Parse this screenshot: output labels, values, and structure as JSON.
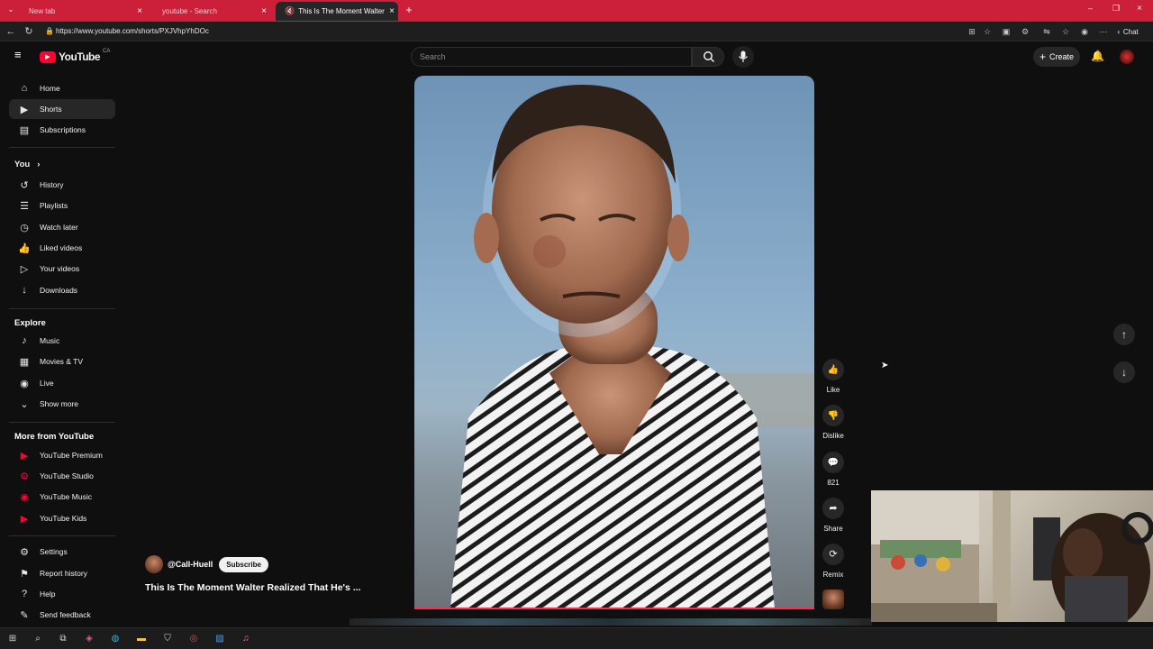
{
  "browser": {
    "tabs": [
      {
        "label": "New tab",
        "active": false
      },
      {
        "label": "youtube - Search",
        "active": false
      },
      {
        "label": "This Is The Moment Walter Re",
        "active": true
      }
    ],
    "url": "https://www.youtube.com/shorts/PXJVhpYhDOc",
    "chat_label": "Chat"
  },
  "header": {
    "logo": "YouTube",
    "region": "CA",
    "search_placeholder": "Search",
    "create_label": "Create"
  },
  "sidebar": {
    "main": [
      {
        "label": "Home",
        "icon": "home-icon",
        "glyph": "⌂"
      },
      {
        "label": "Shorts",
        "icon": "shorts-icon",
        "glyph": "▶"
      },
      {
        "label": "Subscriptions",
        "icon": "subscriptions-icon",
        "glyph": "▤"
      }
    ],
    "you_heading": "You",
    "you": [
      {
        "label": "History",
        "icon": "history-icon",
        "glyph": "↺"
      },
      {
        "label": "Playlists",
        "icon": "playlists-icon",
        "glyph": "☰"
      },
      {
        "label": "Watch later",
        "icon": "clock-icon",
        "glyph": "◷"
      },
      {
        "label": "Liked videos",
        "icon": "thumbs-up-icon",
        "glyph": "👍"
      },
      {
        "label": "Your videos",
        "icon": "video-icon",
        "glyph": "▷"
      },
      {
        "label": "Downloads",
        "icon": "download-icon",
        "glyph": "↓"
      }
    ],
    "explore_heading": "Explore",
    "explore": [
      {
        "label": "Music",
        "icon": "music-icon",
        "glyph": "♪"
      },
      {
        "label": "Movies & TV",
        "icon": "film-icon",
        "glyph": "▦"
      },
      {
        "label": "Live",
        "icon": "live-icon",
        "glyph": "◉"
      },
      {
        "label": "Show more",
        "icon": "chevron-down-icon",
        "glyph": "⌄"
      }
    ],
    "more_heading": "More from YouTube",
    "more": [
      {
        "label": "YouTube Premium",
        "icon": "youtube-premium-icon",
        "glyph": "▶"
      },
      {
        "label": "YouTube Studio",
        "icon": "youtube-studio-icon",
        "glyph": "⚙"
      },
      {
        "label": "YouTube Music",
        "icon": "youtube-music-icon",
        "glyph": "◉"
      },
      {
        "label": "YouTube Kids",
        "icon": "youtube-kids-icon",
        "glyph": "▶"
      }
    ],
    "footer": [
      {
        "label": "Settings",
        "icon": "gear-icon",
        "glyph": "⚙"
      },
      {
        "label": "Report history",
        "icon": "flag-icon",
        "glyph": "⚑"
      },
      {
        "label": "Help",
        "icon": "help-icon",
        "glyph": "?"
      },
      {
        "label": "Send feedback",
        "icon": "feedback-icon",
        "glyph": "✎"
      }
    ]
  },
  "short": {
    "channel": "@Call-Huell",
    "subscribe_label": "Subscribe",
    "title": "This Is The Moment Walter Realized That He's ...",
    "actions": [
      {
        "label": "Like",
        "icon": "thumbs-up-icon",
        "glyph": "👍"
      },
      {
        "label": "Dislike",
        "icon": "thumbs-down-icon",
        "glyph": "👎"
      },
      {
        "label": "821",
        "icon": "comment-icon",
        "glyph": "💬"
      },
      {
        "label": "Share",
        "icon": "share-icon",
        "glyph": "➦"
      },
      {
        "label": "Remix",
        "icon": "remix-icon",
        "glyph": "⟳"
      }
    ],
    "progress_fraction": 1.0
  },
  "colors": {
    "tabbar": "#cc1f3a",
    "brand_red": "#ff0033",
    "background": "#0f0f0f",
    "progress": "#ff2a55"
  }
}
